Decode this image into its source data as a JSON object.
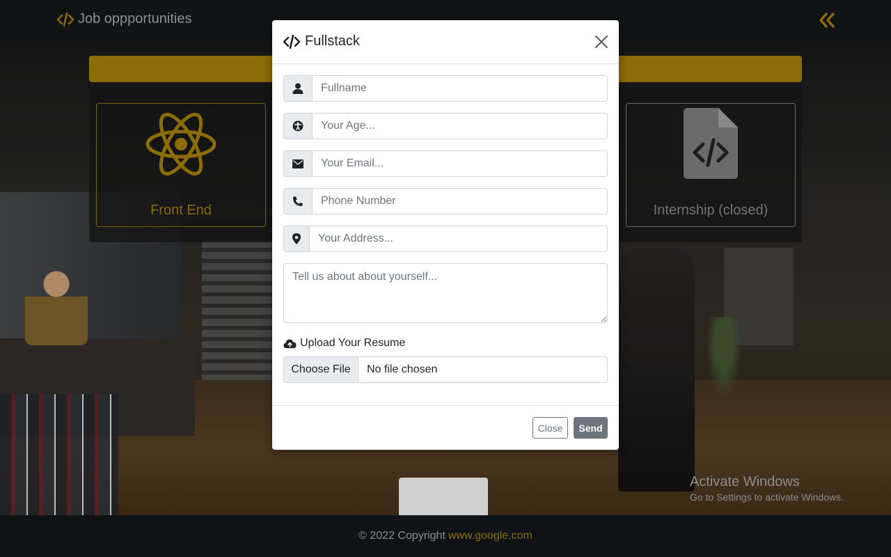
{
  "navbar": {
    "brand_text": "Job oppportunities",
    "brand_icon": "code-icon",
    "collapse_icon": "angle-double-left-icon"
  },
  "page": {
    "cards": [
      {
        "label": "Front End",
        "icon": "react-atom-icon"
      },
      {
        "label": "Internship (closed)",
        "icon": "file-code-icon"
      }
    ]
  },
  "modal": {
    "title": "Fullstack",
    "title_icon": "code-icon",
    "fields": {
      "fullname_placeholder": "Fullname",
      "age_placeholder": "Your Age...",
      "email_placeholder": "Your Email...",
      "phone_placeholder": "Phone Number",
      "address_placeholder": "Your Address...",
      "about_placeholder": "Tell us about about yourself..."
    },
    "upload": {
      "label": "Upload Your Resume",
      "choose_button": "Choose File",
      "status": "No file chosen"
    },
    "buttons": {
      "close": "Close",
      "send": "Send"
    }
  },
  "footer": {
    "copyright": "© 2022 Copyright",
    "link_text": "www.google.com"
  },
  "watermark": {
    "title": "Activate Windows",
    "subtitle": "Go to Settings to activate Windows."
  },
  "colors": {
    "accent": "#8c6c08",
    "navbar_bg": "#101316",
    "modal_bg": "#ffffff",
    "secondary": "#6c757d"
  }
}
